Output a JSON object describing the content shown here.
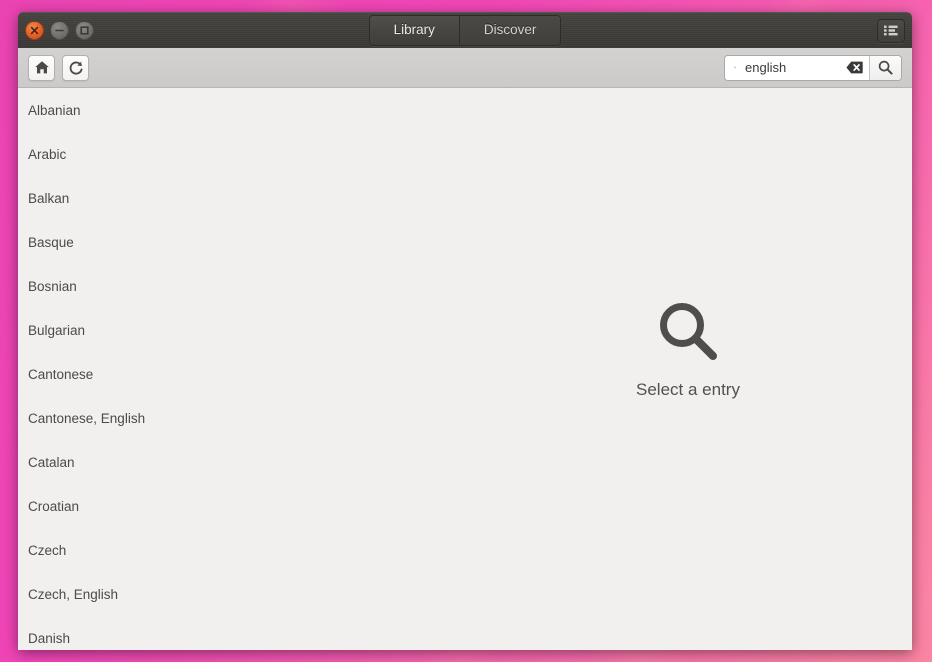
{
  "window": {
    "titlebar": {
      "close_label": "close-window",
      "minimize_label": "minimize-window",
      "maximize_label": "maximize-window",
      "tabs": [
        {
          "label": "Library",
          "active": true
        },
        {
          "label": "Discover",
          "active": false
        }
      ],
      "menu_icon": "list-menu-icon"
    },
    "toolbar": {
      "home_icon": "home-icon",
      "home_tooltip": "Home",
      "reload_icon": "reload-icon",
      "reload_tooltip": "Reload",
      "search": {
        "icon": "search-icon",
        "value": "english",
        "placeholder": "Search",
        "clear_icon": "clear-icon",
        "go_icon": "search-icon"
      }
    },
    "content": {
      "list": {
        "items": [
          "Albanian",
          "Arabic",
          "Balkan",
          "Basque",
          "Bosnian",
          "Bulgarian",
          "Cantonese",
          "Cantonese, English",
          "Catalan",
          "Croatian",
          "Czech",
          "Czech, English",
          "Danish"
        ]
      },
      "placeholder": {
        "icon": "magnifier-icon",
        "text": "Select a entry"
      }
    }
  },
  "colors": {
    "titlebar": "#3f3e3a",
    "toolbar": "#cecdcc",
    "content_bg": "#f1f0ee",
    "text": "#4b4b49",
    "close_button": "#e8622a",
    "desktop_accent": "#a5195a"
  }
}
